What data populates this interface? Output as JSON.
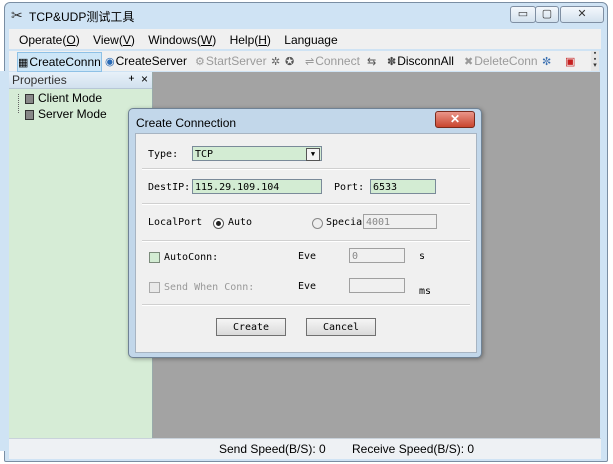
{
  "window": {
    "title": "TCP&UDP测试工具",
    "min_glyph": "▭",
    "max_glyph": "▢",
    "close_glyph": "✕"
  },
  "menu": [
    {
      "label": "Operate(",
      "key": "O",
      "end": ")"
    },
    {
      "label": "View(",
      "key": "V",
      "end": ")"
    },
    {
      "label": "Windows(",
      "key": "W",
      "end": ")"
    },
    {
      "label": "Help(",
      "key": "H",
      "end": ")"
    },
    {
      "label": "Language",
      "key": "",
      "end": ""
    }
  ],
  "toolbar": {
    "create_conn": "CreateConnn",
    "create_server": "CreateServer",
    "start_server": "StartServer",
    "connect": "Connect",
    "disconn_all": "DisconnAll",
    "delete_conn": "DeleteConn"
  },
  "properties": {
    "title": "Properties",
    "pin_glyph": "ᚐ",
    "close_glyph": "×",
    "items": [
      "Client Mode",
      "Server Mode"
    ]
  },
  "status": {
    "send_speed": "Send Speed(B/S): 0",
    "receive_speed": "Receive Speed(B/S): 0"
  },
  "dialog": {
    "title": "Create Connection",
    "close_glyph": "✕",
    "type_label": "Type:",
    "type_value": "TCP",
    "dest_ip_label": "DestIP:",
    "dest_ip_value": "115.29.109.104",
    "port_label": "Port:",
    "port_value": "6533",
    "local_port_label": "LocalPort",
    "auto_label": "Auto",
    "specify_label": "Specia",
    "specify_value": "4001",
    "auto_conn_label": "AutoConn:",
    "auto_conn_every_label": "Eve",
    "auto_conn_value": "0",
    "auto_conn_unit": "s",
    "send_when_conn_label": "Send When Conn:",
    "send_every_label": "Eve",
    "send_every_value": "",
    "send_every_unit": "ms",
    "create_button": "Create",
    "cancel_button": "Cancel"
  }
}
